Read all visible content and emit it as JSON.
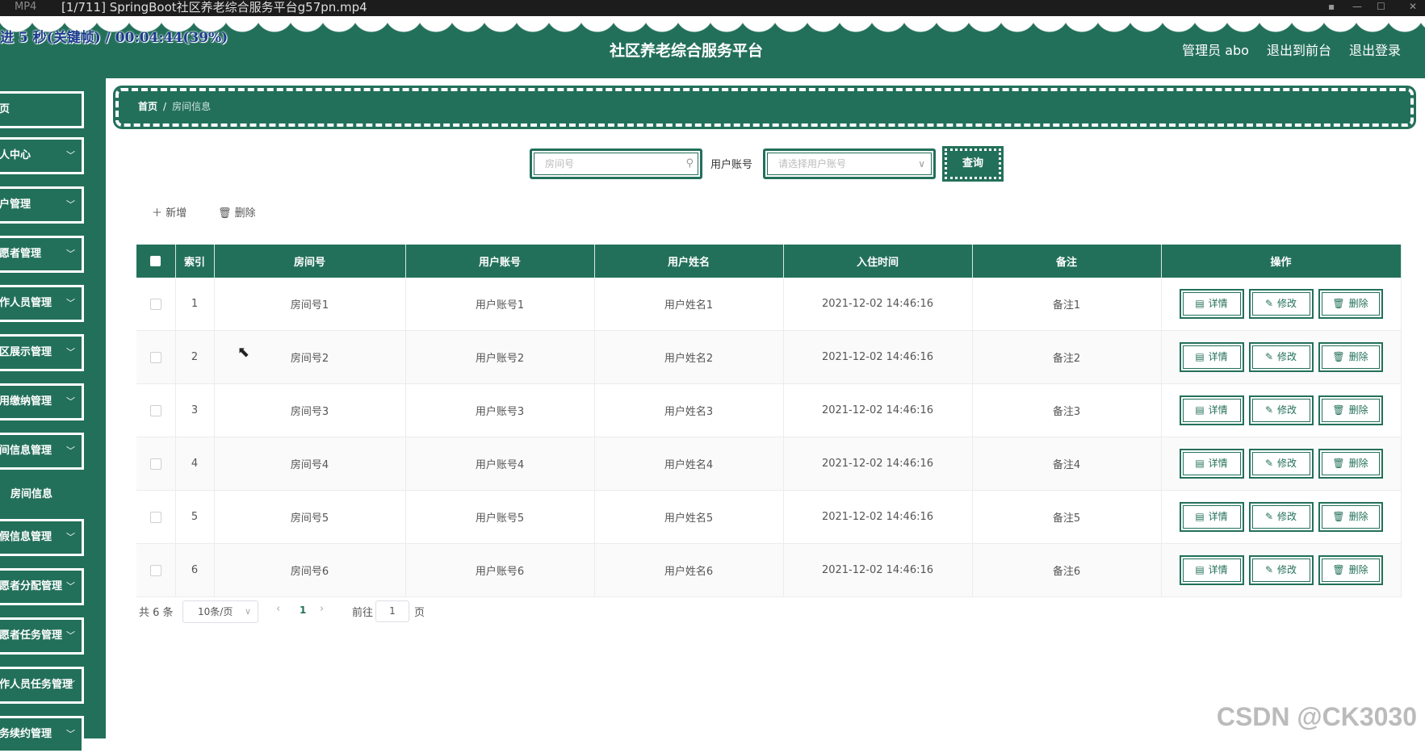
{
  "player": {
    "format": "MP4",
    "file_title": "[1/711] SpringBoot社区养老综合服务平台g57pn.mp4",
    "overlay": "进 5 秒(关键帧) / 00:04:44(39%)"
  },
  "header": {
    "title": "社区养老综合服务平台",
    "links": [
      "管理员 abo",
      "退出到前台",
      "退出登录"
    ]
  },
  "sidebar": {
    "items": [
      {
        "label": "页",
        "chevron": false
      },
      {
        "label": "人中心",
        "chevron": true
      },
      {
        "label": "户管理",
        "chevron": true
      },
      {
        "label": "愿者管理",
        "chevron": true
      },
      {
        "label": "作人员管理",
        "chevron": true
      },
      {
        "label": "区展示管理",
        "chevron": true
      },
      {
        "label": "用缴纳管理",
        "chevron": true
      },
      {
        "label": "间信息管理",
        "chevron": true
      },
      {
        "label": "假信息管理",
        "chevron": true
      },
      {
        "label": "愿者分配管理",
        "chevron": true
      },
      {
        "label": "愿者任务管理",
        "chevron": true
      },
      {
        "label": "作人员任务管理",
        "chevron": true
      },
      {
        "label": "务续约管理",
        "chevron": true
      }
    ],
    "submenu": "房间信息"
  },
  "breadcrumb": {
    "home": "首页",
    "separator": "/",
    "current": "房间信息"
  },
  "search": {
    "room_placeholder": "房间号",
    "user_label": "用户账号",
    "user_placeholder": "请选择用户账号",
    "query_label": "查询"
  },
  "toolbar": {
    "add_label": "新增",
    "delete_label": "删除"
  },
  "table": {
    "headers": [
      "索引",
      "房间号",
      "用户账号",
      "用户姓名",
      "入住时间",
      "备注",
      "操作"
    ],
    "rows": [
      {
        "index": "1",
        "room": "房间号1",
        "account": "用户账号1",
        "name": "用户姓名1",
        "checkin": "2021-12-02 14:46:16",
        "note": "备注1"
      },
      {
        "index": "2",
        "room": "房间号2",
        "account": "用户账号2",
        "name": "用户姓名2",
        "checkin": "2021-12-02 14:46:16",
        "note": "备注2"
      },
      {
        "index": "3",
        "room": "房间号3",
        "account": "用户账号3",
        "name": "用户姓名3",
        "checkin": "2021-12-02 14:46:16",
        "note": "备注3"
      },
      {
        "index": "4",
        "room": "房间号4",
        "account": "用户账号4",
        "name": "用户姓名4",
        "checkin": "2021-12-02 14:46:16",
        "note": "备注4"
      },
      {
        "index": "5",
        "room": "房间号5",
        "account": "用户账号5",
        "name": "用户姓名5",
        "checkin": "2021-12-02 14:46:16",
        "note": "备注5"
      },
      {
        "index": "6",
        "room": "房间号6",
        "account": "用户账号6",
        "name": "用户姓名6",
        "checkin": "2021-12-02 14:46:16",
        "note": "备注6"
      }
    ],
    "actions": {
      "detail": "详情",
      "edit": "修改",
      "delete": "删除"
    }
  },
  "pagination": {
    "total": "共 6 条",
    "page_size": "10条/页",
    "current_page": "1",
    "goto_label": "前往",
    "goto_value": "1",
    "goto_suffix": "页"
  },
  "watermark": "CSDN @CK3030",
  "colors": {
    "primary": "#23705a",
    "white": "#ffffff"
  }
}
